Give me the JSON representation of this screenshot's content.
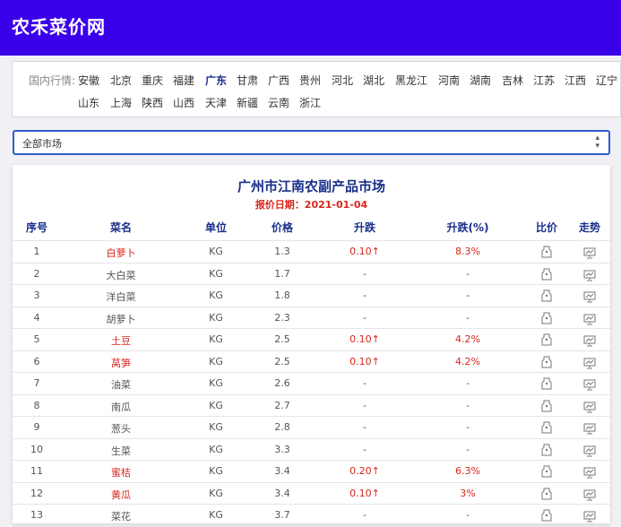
{
  "site": {
    "logo": "农禾菜价网"
  },
  "region": {
    "label": "国内行情:",
    "provinces_row1": [
      "安徽",
      "北京",
      "重庆",
      "福建",
      "广东",
      "甘肃",
      "广西",
      "贵州",
      "河北",
      "湖北",
      "黑龙江",
      "河南",
      "湖南",
      "吉林",
      "江苏",
      "江西",
      "辽宁"
    ],
    "provinces_row2": [
      "山东",
      "上海",
      "陕西",
      "山西",
      "天津",
      "新疆",
      "云南",
      "浙江"
    ],
    "active": "广东"
  },
  "market_select": {
    "value": "全部市场"
  },
  "market": {
    "title": "广州市江南农副产品市场",
    "date_label": "报价日期：2021-01-04"
  },
  "table": {
    "headers": [
      "序号",
      "菜名",
      "单位",
      "价格",
      "升跌",
      "升跌(%)",
      "比价",
      "走势"
    ],
    "rows": [
      {
        "no": "1",
        "name": "白萝卜",
        "unit": "KG",
        "price": "1.3",
        "change": "0.10↑",
        "pct": "8.3%",
        "up": true
      },
      {
        "no": "2",
        "name": "大白菜",
        "unit": "KG",
        "price": "1.7",
        "change": "-",
        "pct": "-",
        "up": false
      },
      {
        "no": "3",
        "name": "洋白菜",
        "unit": "KG",
        "price": "1.8",
        "change": "-",
        "pct": "-",
        "up": false
      },
      {
        "no": "4",
        "name": "胡萝卜",
        "unit": "KG",
        "price": "2.3",
        "change": "-",
        "pct": "-",
        "up": false
      },
      {
        "no": "5",
        "name": "土豆",
        "unit": "KG",
        "price": "2.5",
        "change": "0.10↑",
        "pct": "4.2%",
        "up": true
      },
      {
        "no": "6",
        "name": "莴笋",
        "unit": "KG",
        "price": "2.5",
        "change": "0.10↑",
        "pct": "4.2%",
        "up": true
      },
      {
        "no": "7",
        "name": "油菜",
        "unit": "KG",
        "price": "2.6",
        "change": "-",
        "pct": "-",
        "up": false
      },
      {
        "no": "8",
        "name": "南瓜",
        "unit": "KG",
        "price": "2.7",
        "change": "-",
        "pct": "-",
        "up": false
      },
      {
        "no": "9",
        "name": "葱头",
        "unit": "KG",
        "price": "2.8",
        "change": "-",
        "pct": "-",
        "up": false
      },
      {
        "no": "10",
        "name": "生菜",
        "unit": "KG",
        "price": "3.3",
        "change": "-",
        "pct": "-",
        "up": false
      },
      {
        "no": "11",
        "name": "蜜桔",
        "unit": "KG",
        "price": "3.4",
        "change": "0.20↑",
        "pct": "6.3%",
        "up": true
      },
      {
        "no": "12",
        "name": "黄瓜",
        "unit": "KG",
        "price": "3.4",
        "change": "0.10↑",
        "pct": "3%",
        "up": true
      },
      {
        "no": "13",
        "name": "菜花",
        "unit": "KG",
        "price": "3.7",
        "change": "-",
        "pct": "-",
        "up": false
      }
    ]
  },
  "icons": {
    "compare": "price-tag-icon",
    "trend": "trend-chart-icon"
  },
  "colors": {
    "header_bg": "#3b00ea",
    "accent": "#1a2f8a",
    "up": "#d9261c",
    "select_border": "#2e5fc9"
  }
}
